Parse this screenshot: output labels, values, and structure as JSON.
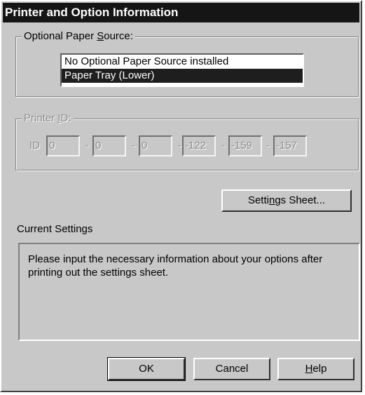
{
  "window": {
    "title": "Printer and Option Information"
  },
  "optional_paper_source": {
    "label_before": "Optional Paper ",
    "label_accel": "S",
    "label_after": "ource:",
    "items": [
      {
        "label": "No Optional Paper Source installed",
        "selected": false
      },
      {
        "label": "Paper Tray (Lower)",
        "selected": true
      }
    ]
  },
  "printer_id": {
    "label_before": "Printer ",
    "label_accel": "I",
    "label_after": "D:",
    "id_label": "ID",
    "separator": "-",
    "fields": [
      "0",
      "0",
      "0",
      "-122",
      "-159",
      "-157"
    ]
  },
  "settings_sheet_button": {
    "before": "Setti",
    "accel": "n",
    "after": "gs Sheet..."
  },
  "current_settings": {
    "label": "Current Settings",
    "message": "Please input the necessary information about your options after printing out the settings sheet."
  },
  "buttons": {
    "ok": "OK",
    "cancel": "Cancel",
    "help_accel": "H",
    "help_rest": "elp"
  },
  "colors": {
    "dialog_bg": "#c8c8c8",
    "title_bg": "#151515",
    "selection_bg": "#1e1e1e",
    "disabled_text": "#8c8c8c"
  }
}
